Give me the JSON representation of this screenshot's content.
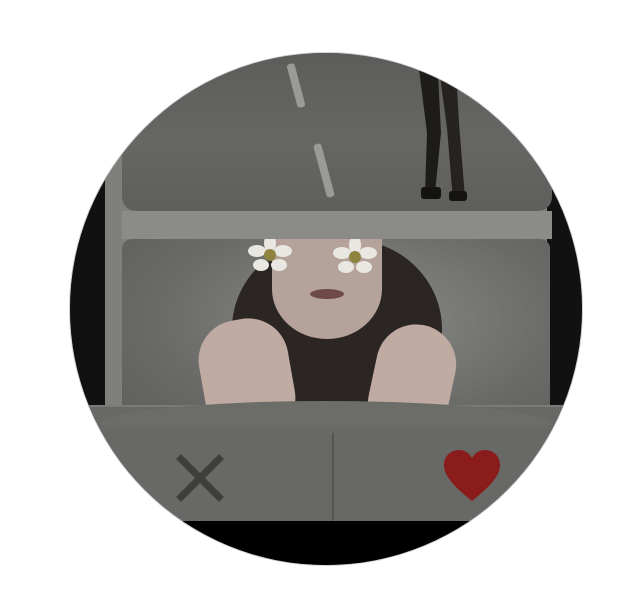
{
  "app": {
    "screen": "card-swipe"
  },
  "cards": {
    "top_card": {
      "image": "road-walker-photo"
    },
    "current_card": {
      "image": "woman-with-daisies-photo"
    }
  },
  "actions": {
    "dislike_icon": "close-x-icon",
    "like_icon": "heart-icon"
  },
  "colors": {
    "like_accent": "#8a1c1c",
    "dislike_icon": "#3e3e3c",
    "bar_background": "#686866",
    "bezel": "#000000"
  }
}
